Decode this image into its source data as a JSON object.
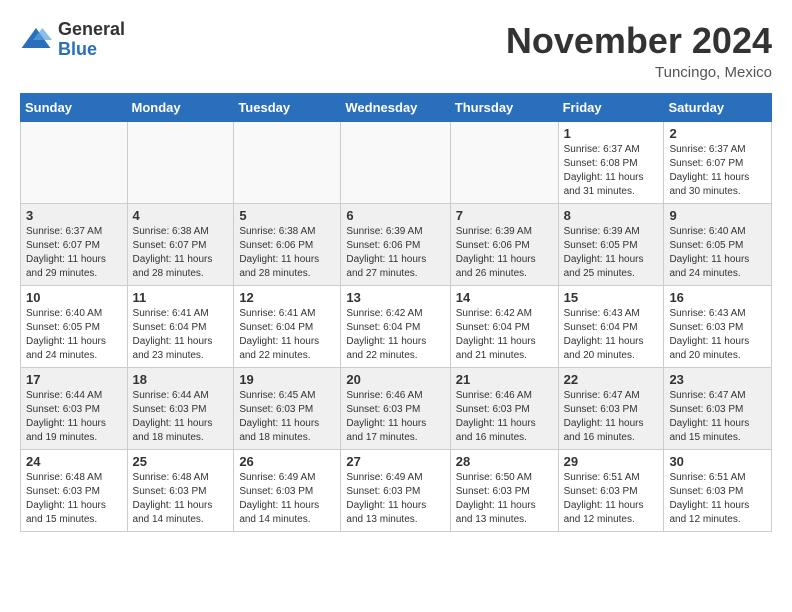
{
  "logo": {
    "general": "General",
    "blue": "Blue"
  },
  "title": "November 2024",
  "location": "Tuncingo, Mexico",
  "days_of_week": [
    "Sunday",
    "Monday",
    "Tuesday",
    "Wednesday",
    "Thursday",
    "Friday",
    "Saturday"
  ],
  "weeks": [
    [
      {
        "day": "",
        "info": ""
      },
      {
        "day": "",
        "info": ""
      },
      {
        "day": "",
        "info": ""
      },
      {
        "day": "",
        "info": ""
      },
      {
        "day": "",
        "info": ""
      },
      {
        "day": "1",
        "info": "Sunrise: 6:37 AM\nSunset: 6:08 PM\nDaylight: 11 hours\nand 31 minutes."
      },
      {
        "day": "2",
        "info": "Sunrise: 6:37 AM\nSunset: 6:07 PM\nDaylight: 11 hours\nand 30 minutes."
      }
    ],
    [
      {
        "day": "3",
        "info": "Sunrise: 6:37 AM\nSunset: 6:07 PM\nDaylight: 11 hours\nand 29 minutes."
      },
      {
        "day": "4",
        "info": "Sunrise: 6:38 AM\nSunset: 6:07 PM\nDaylight: 11 hours\nand 28 minutes."
      },
      {
        "day": "5",
        "info": "Sunrise: 6:38 AM\nSunset: 6:06 PM\nDaylight: 11 hours\nand 28 minutes."
      },
      {
        "day": "6",
        "info": "Sunrise: 6:39 AM\nSunset: 6:06 PM\nDaylight: 11 hours\nand 27 minutes."
      },
      {
        "day": "7",
        "info": "Sunrise: 6:39 AM\nSunset: 6:06 PM\nDaylight: 11 hours\nand 26 minutes."
      },
      {
        "day": "8",
        "info": "Sunrise: 6:39 AM\nSunset: 6:05 PM\nDaylight: 11 hours\nand 25 minutes."
      },
      {
        "day": "9",
        "info": "Sunrise: 6:40 AM\nSunset: 6:05 PM\nDaylight: 11 hours\nand 24 minutes."
      }
    ],
    [
      {
        "day": "10",
        "info": "Sunrise: 6:40 AM\nSunset: 6:05 PM\nDaylight: 11 hours\nand 24 minutes."
      },
      {
        "day": "11",
        "info": "Sunrise: 6:41 AM\nSunset: 6:04 PM\nDaylight: 11 hours\nand 23 minutes."
      },
      {
        "day": "12",
        "info": "Sunrise: 6:41 AM\nSunset: 6:04 PM\nDaylight: 11 hours\nand 22 minutes."
      },
      {
        "day": "13",
        "info": "Sunrise: 6:42 AM\nSunset: 6:04 PM\nDaylight: 11 hours\nand 22 minutes."
      },
      {
        "day": "14",
        "info": "Sunrise: 6:42 AM\nSunset: 6:04 PM\nDaylight: 11 hours\nand 21 minutes."
      },
      {
        "day": "15",
        "info": "Sunrise: 6:43 AM\nSunset: 6:04 PM\nDaylight: 11 hours\nand 20 minutes."
      },
      {
        "day": "16",
        "info": "Sunrise: 6:43 AM\nSunset: 6:03 PM\nDaylight: 11 hours\nand 20 minutes."
      }
    ],
    [
      {
        "day": "17",
        "info": "Sunrise: 6:44 AM\nSunset: 6:03 PM\nDaylight: 11 hours\nand 19 minutes."
      },
      {
        "day": "18",
        "info": "Sunrise: 6:44 AM\nSunset: 6:03 PM\nDaylight: 11 hours\nand 18 minutes."
      },
      {
        "day": "19",
        "info": "Sunrise: 6:45 AM\nSunset: 6:03 PM\nDaylight: 11 hours\nand 18 minutes."
      },
      {
        "day": "20",
        "info": "Sunrise: 6:46 AM\nSunset: 6:03 PM\nDaylight: 11 hours\nand 17 minutes."
      },
      {
        "day": "21",
        "info": "Sunrise: 6:46 AM\nSunset: 6:03 PM\nDaylight: 11 hours\nand 16 minutes."
      },
      {
        "day": "22",
        "info": "Sunrise: 6:47 AM\nSunset: 6:03 PM\nDaylight: 11 hours\nand 16 minutes."
      },
      {
        "day": "23",
        "info": "Sunrise: 6:47 AM\nSunset: 6:03 PM\nDaylight: 11 hours\nand 15 minutes."
      }
    ],
    [
      {
        "day": "24",
        "info": "Sunrise: 6:48 AM\nSunset: 6:03 PM\nDaylight: 11 hours\nand 15 minutes."
      },
      {
        "day": "25",
        "info": "Sunrise: 6:48 AM\nSunset: 6:03 PM\nDaylight: 11 hours\nand 14 minutes."
      },
      {
        "day": "26",
        "info": "Sunrise: 6:49 AM\nSunset: 6:03 PM\nDaylight: 11 hours\nand 14 minutes."
      },
      {
        "day": "27",
        "info": "Sunrise: 6:49 AM\nSunset: 6:03 PM\nDaylight: 11 hours\nand 13 minutes."
      },
      {
        "day": "28",
        "info": "Sunrise: 6:50 AM\nSunset: 6:03 PM\nDaylight: 11 hours\nand 13 minutes."
      },
      {
        "day": "29",
        "info": "Sunrise: 6:51 AM\nSunset: 6:03 PM\nDaylight: 11 hours\nand 12 minutes."
      },
      {
        "day": "30",
        "info": "Sunrise: 6:51 AM\nSunset: 6:03 PM\nDaylight: 11 hours\nand 12 minutes."
      }
    ]
  ]
}
